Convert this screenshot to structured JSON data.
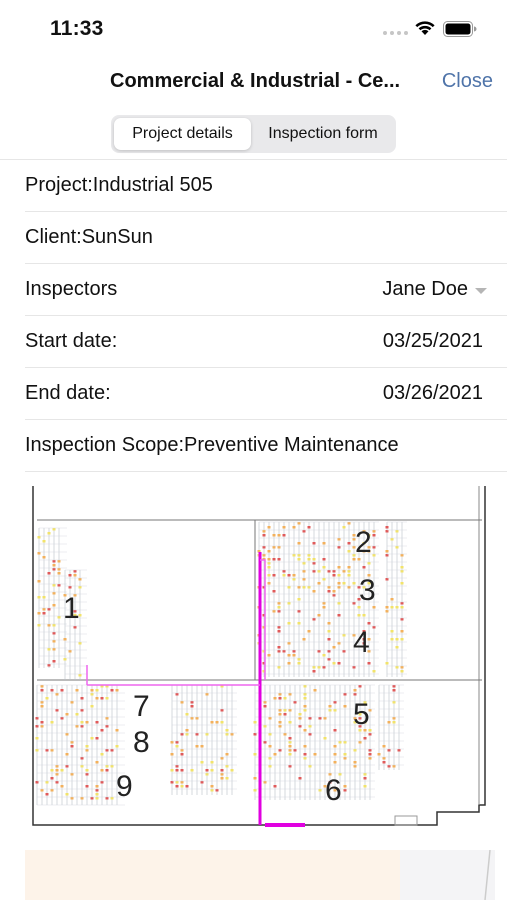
{
  "status_bar": {
    "time": "11:33"
  },
  "nav": {
    "title": "Commercial & Industrial - Ce...",
    "close": "Close"
  },
  "tabs": {
    "project_details": "Project details",
    "inspection_form": "Inspection form"
  },
  "rows": {
    "project": "Project:Industrial 505",
    "client": "Client:SunSun",
    "inspectors_label": "Inspectors",
    "inspectors_value": "Jane Doe",
    "start_label": "Start date:",
    "start_value": "03/25/2021",
    "end_label": "End date:",
    "end_value": "03/26/2021",
    "scope": "Inspection Scope:Preventive Maintenance"
  },
  "floorplan": {
    "zones": [
      "1",
      "2",
      "3",
      "4",
      "5",
      "6",
      "7",
      "8",
      "9"
    ]
  },
  "colors": {
    "accent": "#4f74a9",
    "route": "#e000e0",
    "rack_orange": "#f3b15c",
    "rack_red": "#e05a5a",
    "rack_yellow": "#f2e36a"
  }
}
